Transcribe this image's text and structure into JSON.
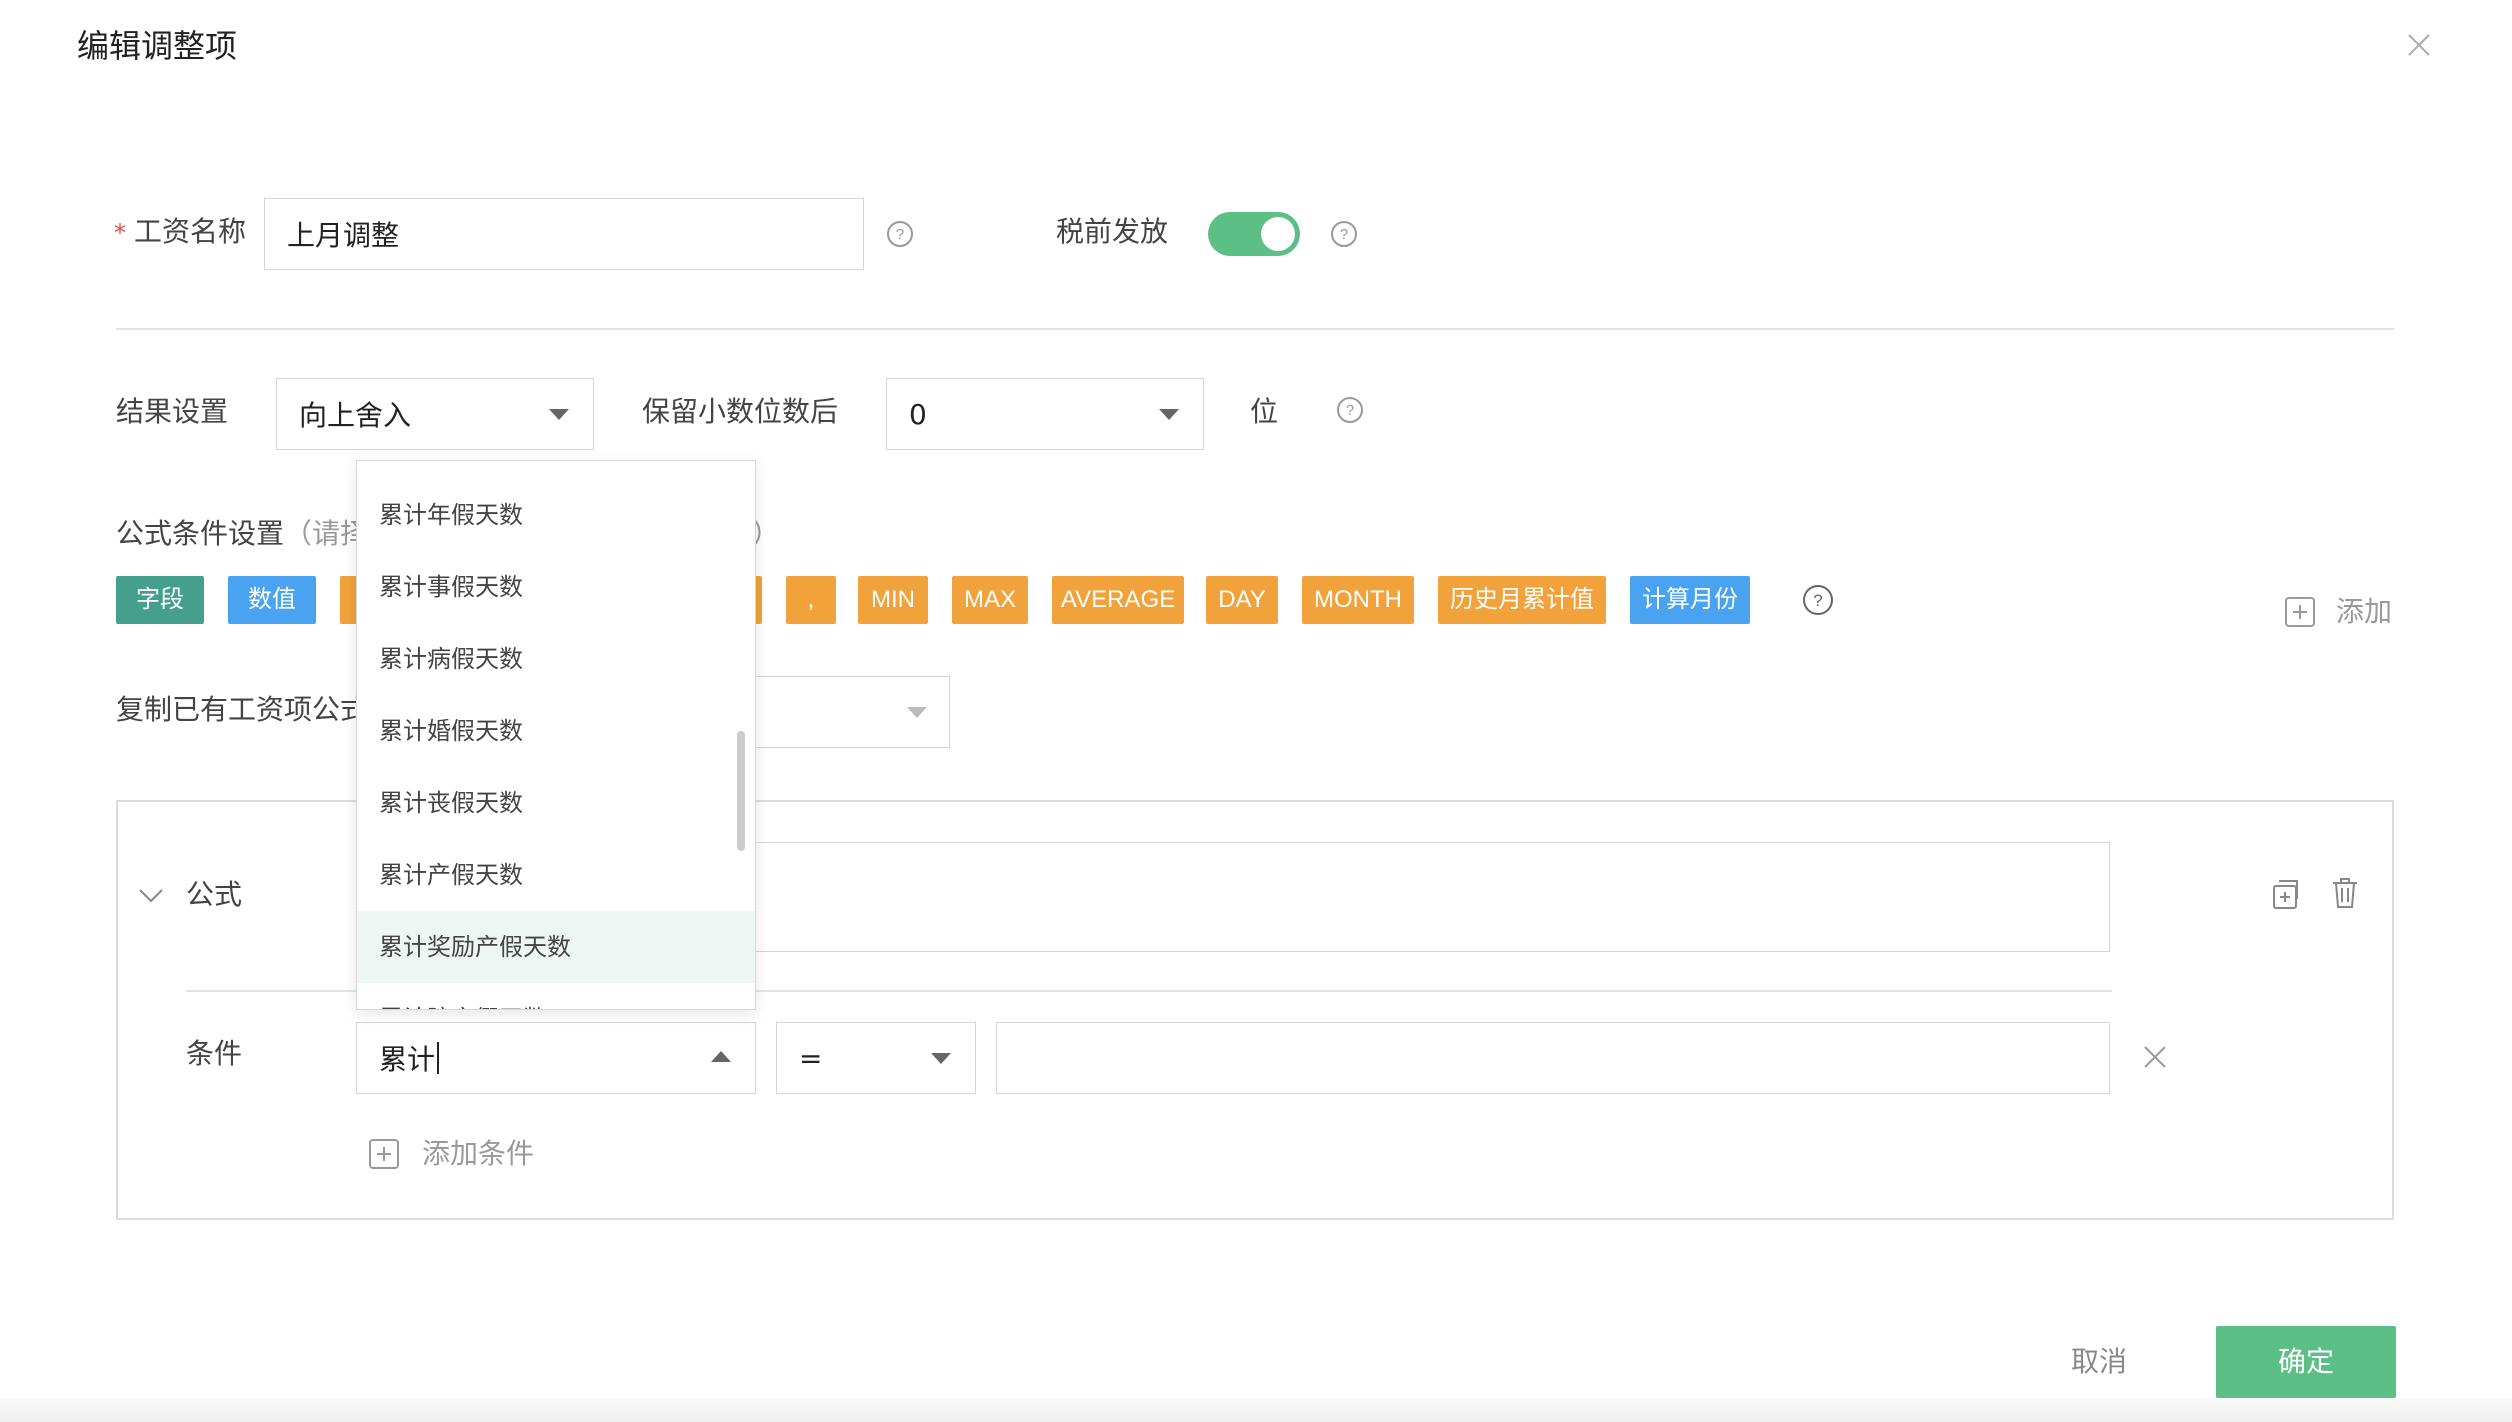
{
  "dialog": {
    "title": "编辑调整项"
  },
  "salary_name": {
    "label": "工资名称",
    "required_mark": "*",
    "value": "上月调整"
  },
  "pretax": {
    "label": "税前发放",
    "enabled": true
  },
  "result_setting": {
    "label": "结果设置",
    "value": "向上舍入"
  },
  "decimal": {
    "label": "保留小数位数后",
    "value": "0",
    "unit": "位"
  },
  "formula_condition": {
    "label": "公式条件设置",
    "hint_start": "（请择",
    "hint_end": "）"
  },
  "tags": {
    "field": "字段",
    "number": "数值",
    "comma": ",",
    "min": "MIN",
    "max": "MAX",
    "average": "AVERAGE",
    "day": "DAY",
    "month": "MONTH",
    "history": "历史月累计值",
    "calc_month": "计算月份"
  },
  "add_label": "添加",
  "copy_formula": {
    "label": "复制已有工资项公式"
  },
  "formula_block": {
    "formula_label": "公式",
    "condition_label": "条件",
    "condition_field_value": "累计",
    "operator_value": "=",
    "condition_value": "",
    "add_condition_label": "添加条件"
  },
  "dropdown_options": [
    "累计年假天数",
    "累计事假天数",
    "累计病假天数",
    "累计婚假天数",
    "累计丧假天数",
    "累计产假天数",
    "累计奖励产假天数",
    "累计陪产假天数"
  ],
  "footer": {
    "cancel": "取消",
    "confirm": "确定"
  },
  "colors": {
    "accent_green": "#5cbf86",
    "tag_teal": "#44a08c",
    "tag_blue": "#4aa3f0",
    "tag_orange": "#f1a23b"
  }
}
